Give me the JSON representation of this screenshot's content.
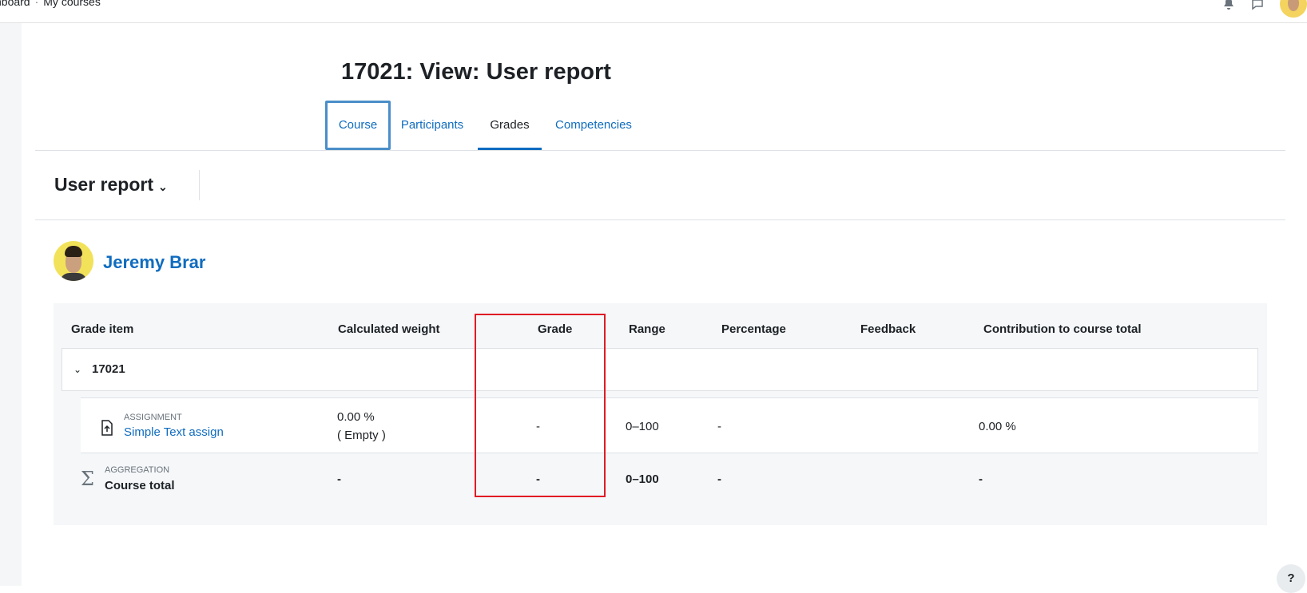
{
  "breadcrumb": {
    "items": [
      "hboard",
      "My courses"
    ]
  },
  "page": {
    "title": "17021: View: User report"
  },
  "secondary_nav": {
    "tabs": [
      {
        "label": "Course"
      },
      {
        "label": "Participants"
      },
      {
        "label": "Grades"
      },
      {
        "label": "Competencies"
      }
    ]
  },
  "report_selector": {
    "label": "User report",
    "caret": "⌄"
  },
  "user": {
    "name": "Jeremy Brar"
  },
  "table": {
    "headers": [
      "Grade item",
      "Calculated weight",
      "Grade",
      "Range",
      "Percentage",
      "Feedback",
      "Contribution to course total"
    ],
    "category": {
      "toggle": "⌄",
      "name": "17021"
    },
    "rows": [
      {
        "type_label": "ASSIGNMENT",
        "name": "Simple Text assign",
        "weight": "0.00 %",
        "weight_note": "( Empty )",
        "grade": "-",
        "range": "0–100",
        "percentage": "-",
        "feedback": "",
        "contribution": "0.00 %"
      },
      {
        "type_label": "AGGREGATION",
        "name": "Course total",
        "weight": "-",
        "grade": "-",
        "range": "0–100",
        "percentage": "-",
        "feedback": "",
        "contribution": "-"
      }
    ]
  },
  "help": {
    "label": "?"
  },
  "colors": {
    "link": "#0f6cbf",
    "highlight": "#e01b24",
    "focus": "#4a8ec9"
  }
}
